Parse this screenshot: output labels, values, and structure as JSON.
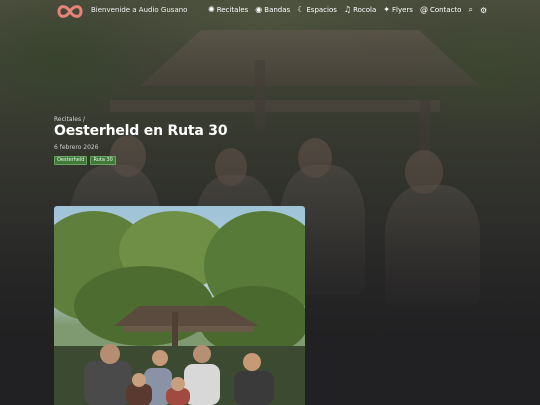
{
  "nav": {
    "brand": "Bienvenide a Audio Gusano",
    "items": [
      {
        "icon": "gear-icon",
        "glyph": "✺",
        "label": "Recitales"
      },
      {
        "icon": "eye-icon",
        "glyph": "◉",
        "label": "Bandas"
      },
      {
        "icon": "moon-icon",
        "glyph": "☾",
        "label": "Espacios"
      },
      {
        "icon": "music-note-icon",
        "glyph": "♫",
        "label": "Rocola"
      },
      {
        "icon": "flame-icon",
        "glyph": "✦",
        "label": "Flyers"
      },
      {
        "icon": "at-icon",
        "glyph": "@",
        "label": "Contacto"
      }
    ],
    "search_glyph": "⌕",
    "settings_glyph": "⚙"
  },
  "post": {
    "breadcrumb": "Recitales /",
    "title": "Oesterheld en Ruta 30",
    "date": "6 febrero 2026",
    "tags": [
      "Oesterheld",
      "Ruta 30"
    ]
  },
  "colors": {
    "accent_tag": "#3f7a3a",
    "logo": "#e8837a"
  }
}
